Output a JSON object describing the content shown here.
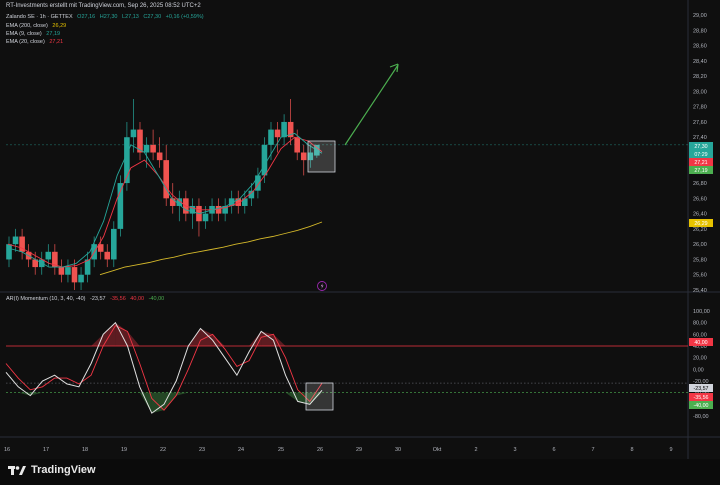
{
  "header": {
    "credit": "RT-Investments erstellt mit TradingView.com, Sep 26, 2025 08:52 UTC+2"
  },
  "legend": {
    "symbol": "Zalando SE · 1h · GETTEX",
    "ohlc": {
      "o": "O27,16",
      "h": "H27,30",
      "l": "L27,13",
      "c": "C27,30",
      "chg": "+0,16 (+0,59%)"
    },
    "ema200": {
      "label": "EMA (200, close)",
      "value": "26,29"
    },
    "ema9": {
      "label": "EMA (9, close)",
      "value": "27,19"
    },
    "ema20": {
      "label": "EMA (20, close)",
      "value": "27,21"
    },
    "momentum": {
      "label": "AR(I) Momentum (10, 3, 40, -40)",
      "v1": "-23,57",
      "v2": "-35,56",
      "v3": "40,00",
      "v4": "-40,00"
    }
  },
  "price_axis": [
    "29,00",
    "28,80",
    "28,60",
    "28,40",
    "28,20",
    "28,00",
    "27,80",
    "27,60",
    "27,40",
    "27,20",
    "27,00",
    "26,80",
    "26,60",
    "26,40",
    "26,20",
    "26,00",
    "25,80",
    "25,60",
    "25,40"
  ],
  "momentum_axis": [
    "100,00",
    "80,00",
    "60,00",
    "40,00",
    "20,00",
    "0,00",
    "-20,00",
    "-40,00",
    "-60,00",
    "-80,00"
  ],
  "time_axis": [
    "16",
    "17",
    "18",
    "19",
    "22",
    "23",
    "24",
    "25",
    "26",
    "29",
    "30",
    "Okt",
    "2",
    "3",
    "6",
    "7",
    "8",
    "9"
  ],
  "price_badges": [
    {
      "text": "27,30",
      "color": "#26a69a"
    },
    {
      "text": "07:29",
      "color": "#26a69a"
    },
    {
      "text": "27,21",
      "color": "#f23645"
    },
    {
      "text": "27,19",
      "color": "#4caf50"
    },
    {
      "text": "26,29",
      "color": "#e6c200"
    }
  ],
  "momentum_badges": [
    {
      "text": "40,00",
      "color": "#f23645"
    },
    {
      "text": "-23,57",
      "color": "#d1d4dc"
    },
    {
      "text": "-35,56",
      "color": "#f23645"
    },
    {
      "text": "-40,00",
      "color": "#4caf50"
    }
  ],
  "colors": {
    "up": "#26a69a",
    "down": "#ef5350",
    "ema200": "#d4b82a",
    "ema9": "#26a69a",
    "ema20": "#f23645",
    "arrow": "#4caf50"
  },
  "logo": {
    "text": "TradingView"
  },
  "chart_data": {
    "type": "candlestick",
    "price_range": [
      25.4,
      29.0
    ],
    "momentum_range": [
      -80,
      100
    ],
    "momentum_levels": [
      40,
      -40
    ],
    "candles": [
      [
        25.8,
        26.1,
        25.7,
        26.0
      ],
      [
        26.0,
        26.2,
        25.9,
        26.1
      ],
      [
        26.1,
        26.2,
        25.8,
        25.9
      ],
      [
        25.9,
        26.0,
        25.7,
        25.8
      ],
      [
        25.8,
        25.9,
        25.6,
        25.7
      ],
      [
        25.7,
        25.9,
        25.6,
        25.8
      ],
      [
        25.8,
        26.0,
        25.7,
        25.9
      ],
      [
        25.9,
        26.0,
        25.6,
        25.7
      ],
      [
        25.7,
        25.8,
        25.5,
        25.6
      ],
      [
        25.6,
        25.8,
        25.5,
        25.7
      ],
      [
        25.7,
        25.8,
        25.4,
        25.5
      ],
      [
        25.5,
        25.7,
        25.4,
        25.6
      ],
      [
        25.6,
        25.9,
        25.5,
        25.8
      ],
      [
        25.8,
        26.1,
        25.7,
        26.0
      ],
      [
        26.0,
        26.1,
        25.8,
        25.9
      ],
      [
        25.9,
        26.0,
        25.7,
        25.8
      ],
      [
        25.8,
        26.3,
        25.7,
        26.2
      ],
      [
        26.2,
        26.9,
        26.1,
        26.8
      ],
      [
        26.8,
        27.6,
        26.7,
        27.4
      ],
      [
        27.4,
        27.9,
        27.2,
        27.5
      ],
      [
        27.5,
        27.6,
        27.1,
        27.2
      ],
      [
        27.2,
        27.4,
        27.0,
        27.3
      ],
      [
        27.3,
        27.5,
        27.1,
        27.2
      ],
      [
        27.2,
        27.4,
        27.0,
        27.1
      ],
      [
        27.1,
        27.3,
        26.5,
        26.6
      ],
      [
        26.6,
        26.8,
        26.4,
        26.5
      ],
      [
        26.5,
        26.7,
        26.3,
        26.6
      ],
      [
        26.6,
        26.7,
        26.3,
        26.4
      ],
      [
        26.4,
        26.6,
        26.2,
        26.5
      ],
      [
        26.5,
        26.6,
        26.1,
        26.3
      ],
      [
        26.3,
        26.5,
        26.2,
        26.4
      ],
      [
        26.4,
        26.6,
        26.3,
        26.5
      ],
      [
        26.5,
        26.6,
        26.3,
        26.4
      ],
      [
        26.4,
        26.6,
        26.3,
        26.5
      ],
      [
        26.5,
        26.7,
        26.4,
        26.6
      ],
      [
        26.6,
        26.7,
        26.4,
        26.5
      ],
      [
        26.5,
        26.7,
        26.4,
        26.6
      ],
      [
        26.6,
        26.8,
        26.5,
        26.7
      ],
      [
        26.7,
        27.0,
        26.6,
        26.9
      ],
      [
        26.9,
        27.4,
        26.8,
        27.3
      ],
      [
        27.3,
        27.6,
        27.1,
        27.5
      ],
      [
        27.5,
        27.6,
        27.2,
        27.4
      ],
      [
        27.4,
        27.7,
        27.3,
        27.6
      ],
      [
        27.6,
        27.9,
        27.3,
        27.4
      ],
      [
        27.4,
        27.5,
        27.1,
        27.2
      ],
      [
        27.2,
        27.3,
        26.9,
        27.1
      ],
      [
        27.1,
        27.3,
        27.0,
        27.2
      ],
      [
        27.16,
        27.3,
        27.13,
        27.3
      ]
    ],
    "ema200": [
      25.6,
      25.65,
      25.7,
      25.73,
      25.76,
      25.8,
      25.83,
      25.87,
      25.9,
      25.93,
      25.96,
      26.0,
      26.03,
      26.07,
      26.1,
      26.14,
      26.18,
      26.23,
      26.29
    ],
    "ema9": [
      25.95,
      25.9,
      25.8,
      25.7,
      25.7,
      25.75,
      25.9,
      26.3,
      26.9,
      27.3,
      27.2,
      26.9,
      26.6,
      26.45,
      26.4,
      26.45,
      26.5,
      26.6,
      26.8,
      27.1,
      27.4,
      27.45,
      27.3,
      27.19
    ],
    "ema20": [
      26.0,
      25.95,
      25.85,
      25.75,
      25.7,
      25.72,
      25.8,
      26.1,
      26.6,
      27.0,
      27.1,
      26.9,
      26.65,
      26.5,
      26.45,
      26.45,
      26.48,
      26.55,
      26.7,
      26.95,
      27.25,
      27.4,
      27.35,
      27.21
    ],
    "momentum_white": [
      -5,
      -30,
      -45,
      -20,
      -10,
      -25,
      -30,
      10,
      60,
      80,
      40,
      -30,
      -75,
      -60,
      -20,
      40,
      70,
      50,
      20,
      -10,
      30,
      65,
      50,
      -10,
      -55,
      -60,
      -36
    ],
    "momentum_red": [
      10,
      -15,
      -35,
      -30,
      -15,
      -15,
      -25,
      -10,
      40,
      75,
      65,
      10,
      -50,
      -70,
      -45,
      0,
      50,
      60,
      35,
      5,
      15,
      55,
      60,
      20,
      -35,
      -55,
      -24
    ]
  }
}
